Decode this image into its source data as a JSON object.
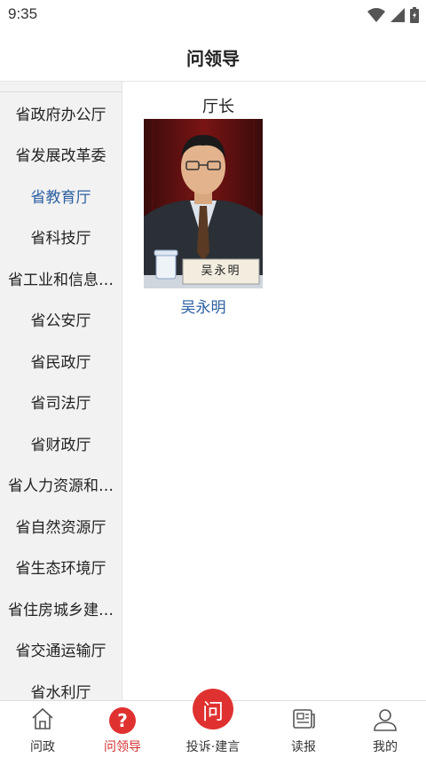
{
  "status": {
    "time": "9:35"
  },
  "header": {
    "title": "问领导"
  },
  "sidebar": {
    "items": [
      {
        "label": "省政府办公厅"
      },
      {
        "label": "省发展改革委"
      },
      {
        "label": "省教育厅",
        "active": true
      },
      {
        "label": "省科技厅"
      },
      {
        "label": "省工业和信息…"
      },
      {
        "label": "省公安厅"
      },
      {
        "label": "省民政厅"
      },
      {
        "label": "省司法厅"
      },
      {
        "label": "省财政厅"
      },
      {
        "label": "省人力资源和…"
      },
      {
        "label": "省自然资源厅"
      },
      {
        "label": "省生态环境厅"
      },
      {
        "label": "省住房城乡建…"
      },
      {
        "label": "省交通运输厅"
      },
      {
        "label": "省水利厅"
      }
    ]
  },
  "main": {
    "section_title": "厅长",
    "leader": {
      "name": "吴永明",
      "nameplate": "吴永明"
    }
  },
  "tabbar": {
    "items": [
      {
        "label": "问政",
        "icon": "home-icon"
      },
      {
        "label": "问领导",
        "icon": "question-icon",
        "active": true
      },
      {
        "label": "投诉·建言",
        "icon": "ask-icon",
        "glyph": "问"
      },
      {
        "label": "读报",
        "icon": "newspaper-icon"
      },
      {
        "label": "我的",
        "icon": "user-icon"
      }
    ]
  },
  "colors": {
    "accent_red": "#e03131",
    "active_blue": "#2c5fa0",
    "sidebar_bg": "#f2f2f2"
  }
}
